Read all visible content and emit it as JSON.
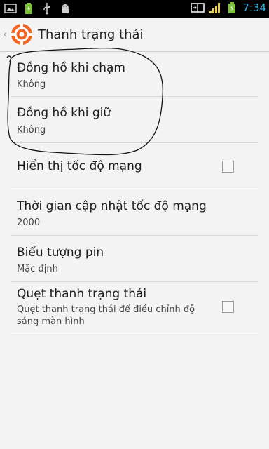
{
  "status_bar": {
    "time": "7:34",
    "icons": [
      "image-icon",
      "battery-icon",
      "usb-icon",
      "android-icon",
      "dual-sim-icon",
      "signal-icon",
      "battery-charging-icon"
    ]
  },
  "action_bar": {
    "title": "Thanh trạng thái",
    "app_icon": "orange-settings-icon"
  },
  "settings": [
    {
      "label": "Đồng hồ khi chạm",
      "summary": "Không",
      "has_checkbox": false
    },
    {
      "label": "Đồng hồ khi giữ",
      "summary": "Không",
      "has_checkbox": false
    },
    {
      "label": "Hiển thị tốc độ mạng",
      "summary": "",
      "has_checkbox": true,
      "checked": false
    },
    {
      "label": "Thời gian cập nhật tốc độ mạng",
      "summary": "2000",
      "has_checkbox": false
    },
    {
      "label": "Biểu tượng pin",
      "summary": "Mặc định",
      "has_checkbox": false
    },
    {
      "label": "Quẹt thanh trạng thái",
      "summary": "Quẹt thanh trạng thái để điều chỉnh độ sáng màn hình",
      "has_checkbox": true,
      "checked": false
    }
  ],
  "colors": {
    "accent": "#33b5e5",
    "app_icon": "#f26522",
    "background": "#f3f3f3"
  }
}
